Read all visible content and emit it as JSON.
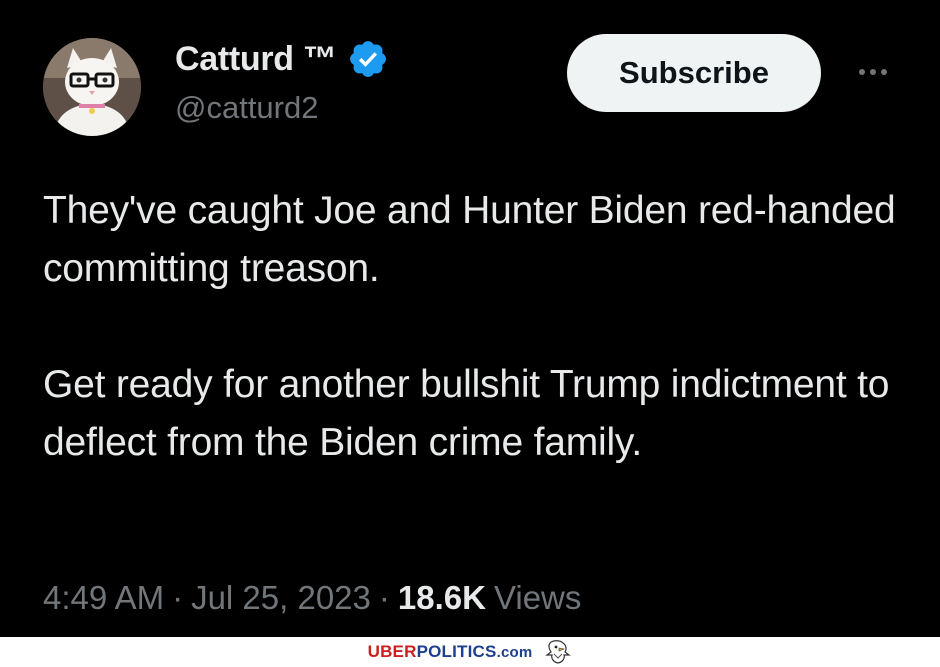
{
  "author": {
    "display_name": "Catturd ™",
    "handle": "@catturd2",
    "verified": true,
    "avatar": "cat-with-glasses-avatar"
  },
  "actions": {
    "subscribe_label": "Subscribe",
    "more_icon": "more-horizontal-icon"
  },
  "tweet": {
    "paragraphs": [
      "They've caught Joe and Hunter Biden red-handed committing treason.",
      "Get ready for another bullshit Trump indictment to deflect from the Biden crime family."
    ]
  },
  "meta": {
    "time": "4:49 AM",
    "separator": "·",
    "date": "Jul 25, 2023",
    "views_count": "18.6K",
    "views_label": "Views"
  },
  "footer": {
    "brand_part1": "UBER",
    "brand_part2": "POLITICS",
    "brand_part3": ".com",
    "logo_icon": "eagle-icon"
  },
  "colors": {
    "background": "#000000",
    "primary_text": "#e7e9ea",
    "secondary_text": "#71767b",
    "verified_blue": "#1d9bf0",
    "subscribe_bg": "#eff3f4"
  }
}
